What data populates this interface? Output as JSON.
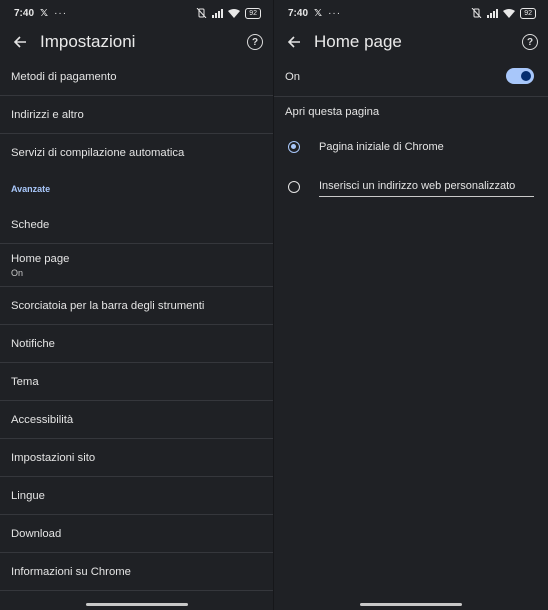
{
  "left": {
    "status": {
      "time": "7:40",
      "battery": "92"
    },
    "title": "Impostazioni",
    "items_top": [
      {
        "label": "Metodi di pagamento"
      },
      {
        "label": "Indirizzi e altro"
      },
      {
        "label": "Servizi di compilazione automatica"
      }
    ],
    "section": "Avanzate",
    "items_adv": [
      {
        "label": "Schede"
      },
      {
        "label": "Home page",
        "sub": "On"
      },
      {
        "label": "Scorciatoia per la barra degli strumenti"
      },
      {
        "label": "Notifiche"
      },
      {
        "label": "Tema"
      },
      {
        "label": "Accessibilità"
      },
      {
        "label": "Impostazioni sito"
      },
      {
        "label": "Lingue"
      },
      {
        "label": "Download"
      },
      {
        "label": "Informazioni su Chrome"
      }
    ]
  },
  "right": {
    "status": {
      "time": "7:40",
      "battery": "92"
    },
    "title": "Home page",
    "toggle_label": "On",
    "toggle_on": true,
    "section_label": "Apri questa pagina",
    "options": [
      {
        "label": "Pagina iniziale di Chrome",
        "selected": true
      },
      {
        "label": "Inserisci un indirizzo web personalizzato",
        "selected": false
      }
    ]
  },
  "colors": {
    "background": "#1f2125",
    "accent": "#a8c7fa",
    "divider": "#35373c"
  }
}
